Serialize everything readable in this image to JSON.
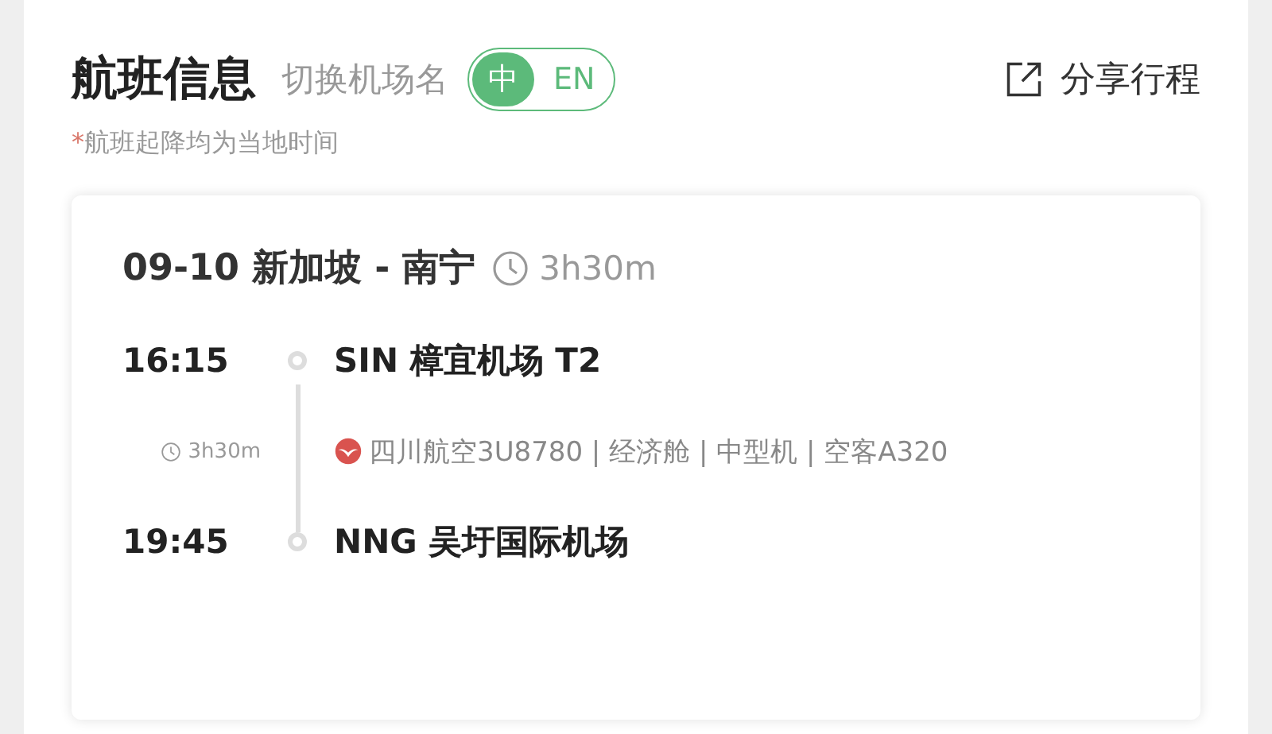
{
  "header": {
    "title": "航班信息",
    "switch_label": "切换机场名",
    "language_options": [
      {
        "label": "中",
        "selected": true
      },
      {
        "label": "EN",
        "selected": false
      }
    ],
    "share": "分享行程"
  },
  "note": {
    "mark": "*",
    "text": "航班起降均为当地时间"
  },
  "flight": {
    "date": "09-10",
    "route": "新加坡 - 南宁",
    "duration": "3h30m",
    "departure": {
      "time": "16:15",
      "airport": "SIN 樟宜机场 T2"
    },
    "leg": {
      "duration": "3h30m",
      "info": "四川航空3U8780 | 经济舱 | 中型机 | 空客A320"
    },
    "arrival": {
      "time": "19:45",
      "airport": "NNG 吴圩国际机场"
    }
  }
}
